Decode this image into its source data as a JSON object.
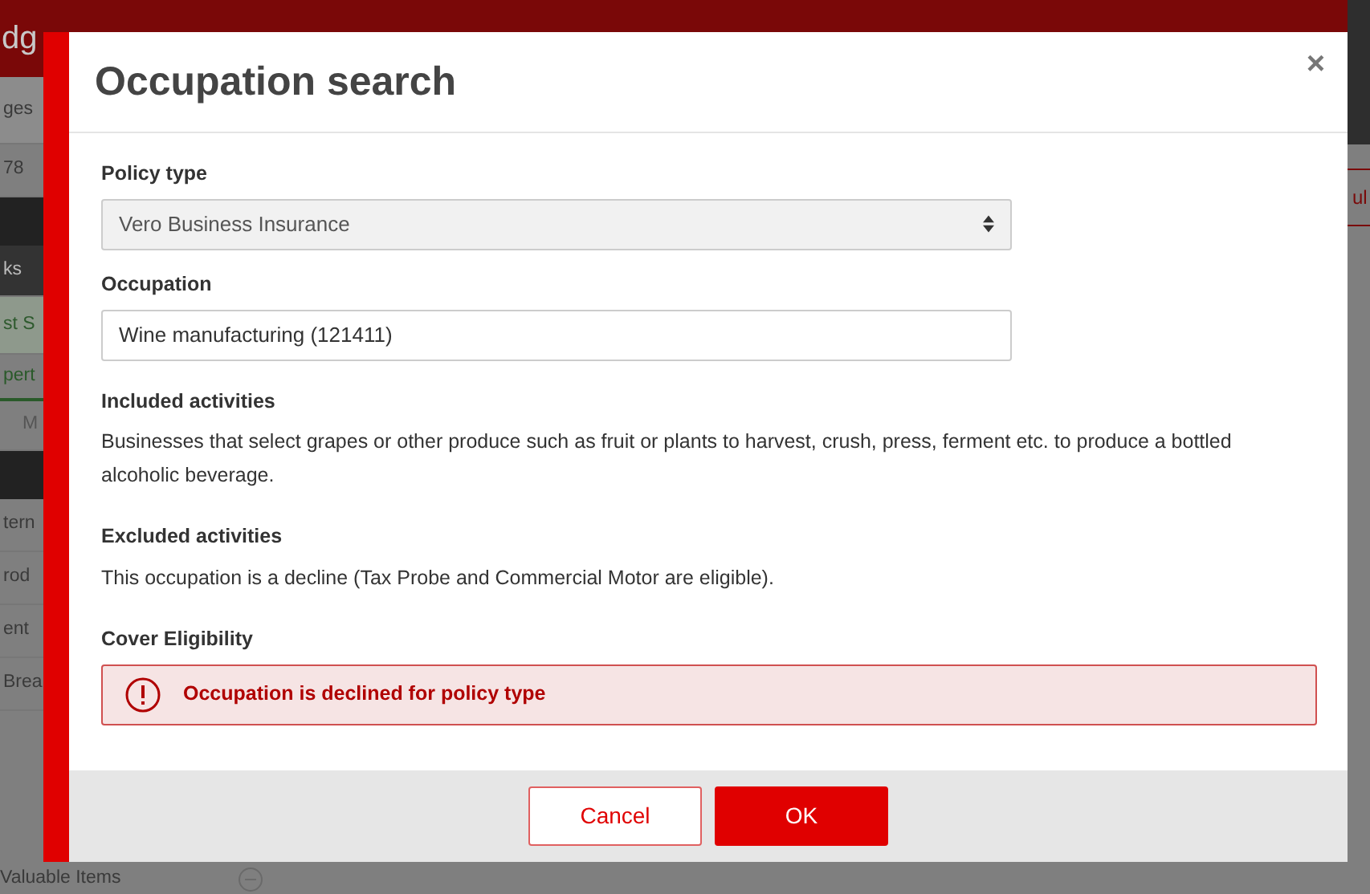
{
  "background": {
    "logo": "dg",
    "sidebar_items": [
      {
        "kind": "nav",
        "text": "ges"
      },
      {
        "kind": "plain",
        "text": "78"
      },
      {
        "kind": "band"
      },
      {
        "kind": "dark",
        "text": "ks"
      },
      {
        "kind": "green",
        "text": "st S"
      },
      {
        "kind": "link",
        "text": "pert"
      },
      {
        "kind": "muted",
        "text": "M"
      },
      {
        "kind": "band"
      },
      {
        "kind": "plain",
        "text": "tern"
      },
      {
        "kind": "plain",
        "text": "rod"
      },
      {
        "kind": "plain",
        "text": "ent"
      },
      {
        "kind": "plain",
        "text": "Brea"
      },
      {
        "kind": "remove",
        "text": "Valuable Items"
      }
    ],
    "right_tab": "ul"
  },
  "dialog": {
    "title": "Occupation search",
    "close": "×",
    "policy_type": {
      "label": "Policy type",
      "value": "Vero Business Insurance"
    },
    "occupation": {
      "label": "Occupation",
      "value": "Wine manufacturing (121411)"
    },
    "sections": [
      {
        "heading": "Included activities",
        "text": "Businesses that select grapes or other produce such as fruit or plants to harvest, crush, press, ferment etc. to produce a bottled alcoholic beverage."
      },
      {
        "heading": "Excluded activities",
        "text": "This occupation is a decline (Tax Probe and Commercial Motor are eligible)."
      }
    ],
    "eligibility": {
      "heading": "Cover Eligibility",
      "message": "Occupation is declined for policy type"
    },
    "buttons": [
      {
        "label": "Cancel",
        "kind": "secondary"
      },
      {
        "label": "OK",
        "kind": "primary"
      }
    ]
  }
}
